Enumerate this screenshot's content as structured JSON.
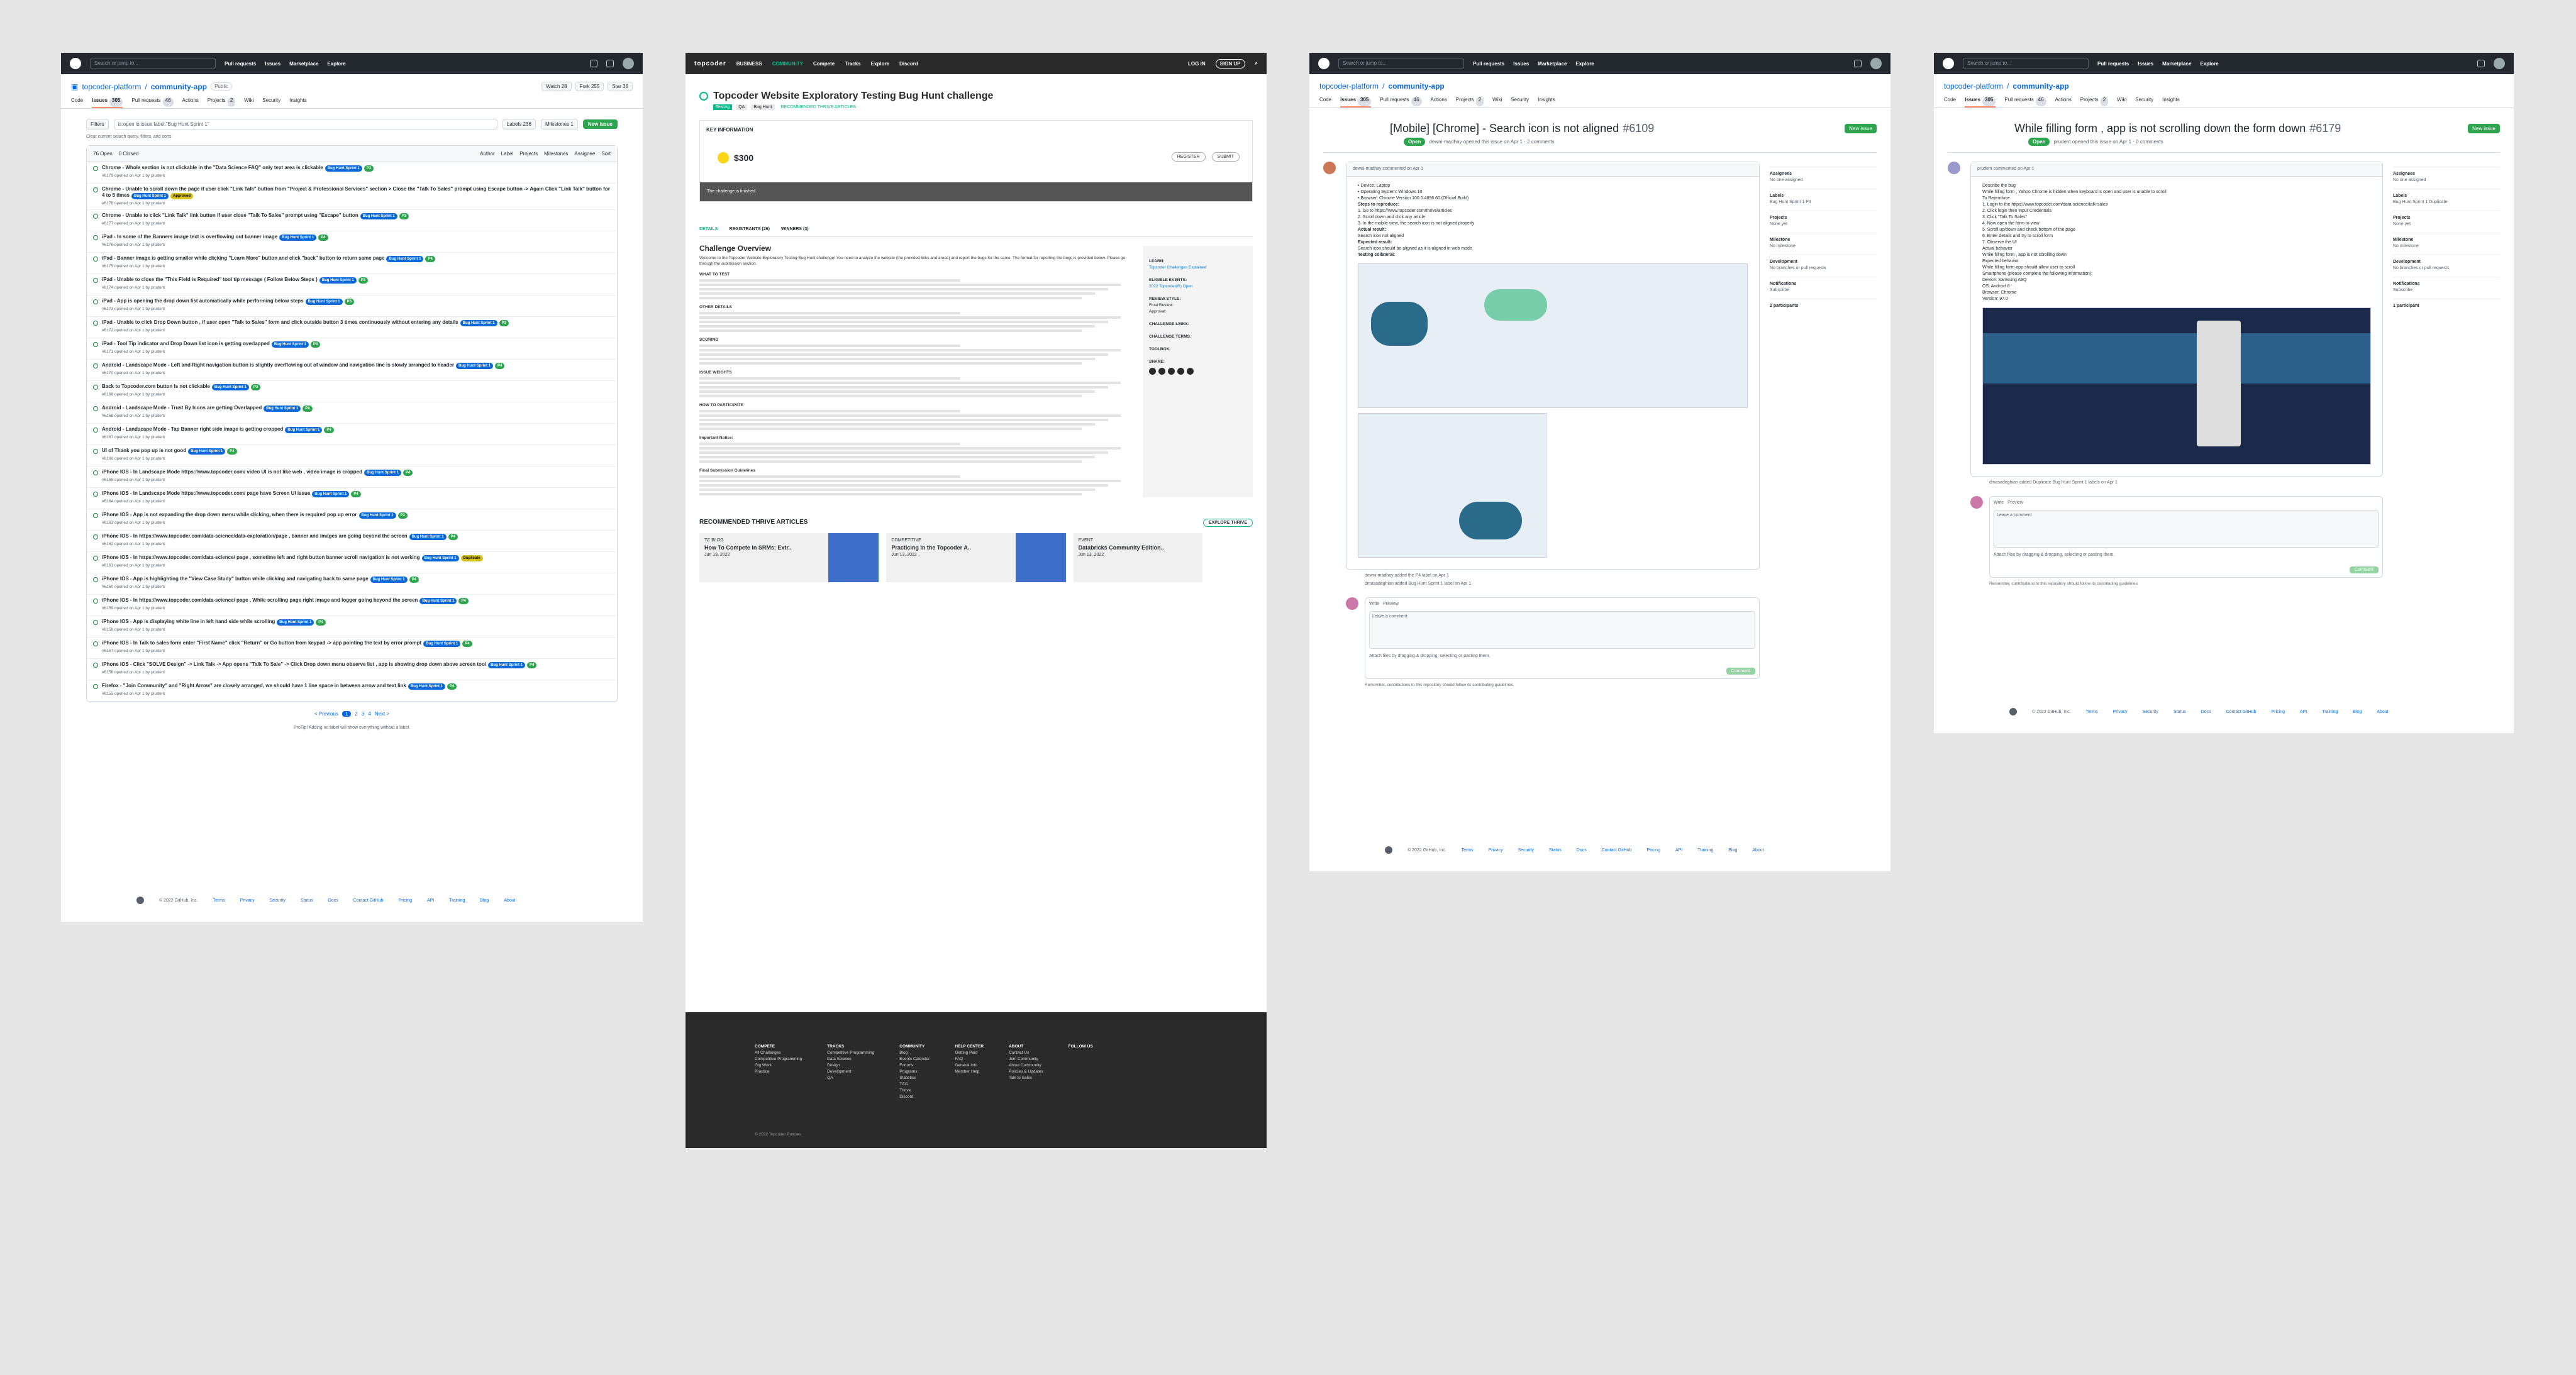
{
  "panel1": {
    "search_placeholder": "Search or jump to...",
    "nav": [
      "Pull requests",
      "Issues",
      "Marketplace",
      "Explore"
    ],
    "repo": {
      "owner": "topcoder-platform",
      "name": "community-app",
      "visibility": "Public"
    },
    "repo_buttons": [
      "Watch 28",
      "Fork 255",
      "Star 36"
    ],
    "tabs": [
      {
        "label": "Code",
        "count": ""
      },
      {
        "label": "Issues",
        "count": "305"
      },
      {
        "label": "Pull requests",
        "count": "46"
      },
      {
        "label": "Actions",
        "count": ""
      },
      {
        "label": "Projects",
        "count": "2"
      },
      {
        "label": "Wiki",
        "count": ""
      },
      {
        "label": "Security",
        "count": ""
      },
      {
        "label": "Insights",
        "count": ""
      }
    ],
    "filters_label": "Filters",
    "filter_query": "is:open is:issue label:\"Bug Hunt Sprint 1\"",
    "labels_btn": "Labels 236",
    "milestones_btn": "Milestones 1",
    "new_issue": "New issue",
    "clear_filter": "Clear current search query, filters, and sorts",
    "list_header": {
      "open": "76 Open",
      "closed": "0 Closed",
      "filters": [
        "Author",
        "Label",
        "Projects",
        "Milestones",
        "Assignee",
        "Sort"
      ]
    },
    "issues": [
      {
        "title": "Chrome - Whole section is not clickable in the \"Data Science FAQ\" only text area is clickable",
        "labels": [
          "Bug Hunt Sprint 1",
          "P3"
        ],
        "meta": "#6179 opened on Apr 1 by prudent"
      },
      {
        "title": "Chrome - Unable to scroll down the page if user click \"Link Talk\" button from \"Project & Professional Services\" section > Close the \"Talk To Sales\" prompt using Escape button -> Again Click \"Link Talk\" button for 4 to 5 times",
        "labels": [
          "Bug Hunt Sprint 1",
          "Approved"
        ],
        "meta": "#6178 opened on Apr 1 by prudent"
      },
      {
        "title": "Chrome - Unable to click \"Link Talk\" link button if user close \"Talk To Sales\" prompt using \"Escape\" button",
        "labels": [
          "Bug Hunt Sprint 1",
          "P3"
        ],
        "meta": "#6177 opened on Apr 1 by prudent"
      },
      {
        "title": "iPad - In some of the Banners image text is overflowing out banner image",
        "labels": [
          "Bug Hunt Sprint 1",
          "P4"
        ],
        "meta": "#6176 opened on Apr 1 by prudent"
      },
      {
        "title": "iPad - Banner image is getting smaller while clicking \"Learn More\" button and click \"back\" button to return same page",
        "labels": [
          "Bug Hunt Sprint 1",
          "P4"
        ],
        "meta": "#6175 opened on Apr 1 by prudent"
      },
      {
        "title": "iPad - Unable to close the \"This Field is Required\" tool tip message ( Follow Below Steps )",
        "labels": [
          "Bug Hunt Sprint 1",
          "P3"
        ],
        "meta": "#6174 opened on Apr 1 by prudent"
      },
      {
        "title": "iPad - App is opening the drop down list automatically while performing below steps",
        "labels": [
          "Bug Hunt Sprint 1",
          "P3"
        ],
        "meta": "#6173 opened on Apr 1 by prudent"
      },
      {
        "title": "iPad - Unable to click Drop Down button , if user open \"Talk to Sales\" form and click outside button 3 times continuously without entering any details",
        "labels": [
          "Bug Hunt Sprint 1",
          "P3"
        ],
        "meta": "#6172 opened on Apr 1 by prudent"
      },
      {
        "title": "iPad - Tool Tip indicator and Drop Down list icon is getting overlapped",
        "labels": [
          "Bug Hunt Sprint 1",
          "P4"
        ],
        "meta": "#6171 opened on Apr 1 by prudent"
      },
      {
        "title": "Android - Landscape Mode - Left and Right navigation button is slightly overflowing out of window and navigation line is slowly arranged to header",
        "labels": [
          "Bug Hunt Sprint 1",
          "P4"
        ],
        "meta": "#6170 opened on Apr 1 by prudent"
      },
      {
        "title": "Back to Topcoder.com button is not clickable",
        "labels": [
          "Bug Hunt Sprint 1",
          "P3"
        ],
        "meta": "#6169 opened on Apr 1 by prudent"
      },
      {
        "title": "Android - Landscape Mode - Trust By Icons are getting Overlapped",
        "labels": [
          "Bug Hunt Sprint 1",
          "P4"
        ],
        "meta": "#6168 opened on Apr 1 by prudent"
      },
      {
        "title": "Android - Landscape Mode - Tap Banner right side image is getting cropped",
        "labels": [
          "Bug Hunt Sprint 1",
          "P4"
        ],
        "meta": "#6167 opened on Apr 1 by prudent"
      },
      {
        "title": "UI of Thank you pop up is not good",
        "labels": [
          "Bug Hunt Sprint 1",
          "P4"
        ],
        "meta": "#6166 opened on Apr 1 by prudent"
      },
      {
        "title": "iPhone IOS - In Landscape Mode https://www.topcoder.com/ video UI is not like web , video image is cropped",
        "labels": [
          "Bug Hunt Sprint 1",
          "P4"
        ],
        "meta": "#6165 opened on Apr 1 by prudent"
      },
      {
        "title": "iPhone IOS - In Landscape Mode https://www.topcoder.com/ page have Screen UI issue",
        "labels": [
          "Bug Hunt Sprint 1",
          "P4"
        ],
        "meta": "#6164 opened on Apr 1 by prudent"
      },
      {
        "title": "iPhone IOS - App is not expanding the drop down menu while clicking, when there is required pop up error",
        "labels": [
          "Bug Hunt Sprint 1",
          "P3"
        ],
        "meta": "#6163 opened on Apr 1 by prudent"
      },
      {
        "title": "iPhone IOS - In https://www.topcoder.com/data-science/data-exploration/page , banner and images are going beyond the screen",
        "labels": [
          "Bug Hunt Sprint 1",
          "P4"
        ],
        "meta": "#6162 opened on Apr 1 by prudent"
      },
      {
        "title": "iPhone IOS - In https://www.topcoder.com/data-science/ page , sometime left and right button banner scroll navigation is not working",
        "labels": [
          "Bug Hunt Sprint 1",
          "Duplicate"
        ],
        "meta": "#6161 opened on Apr 1 by prudent"
      },
      {
        "title": "iPhone IOS - App is highlighting the \"View Case Study\" button while clicking and navigating back to same page",
        "labels": [
          "Bug Hunt Sprint 1",
          "P4"
        ],
        "meta": "#6160 opened on Apr 1 by prudent"
      },
      {
        "title": "iPhone IOS - In https://www.topcoder.com/data-science/ page , While scrolling page right image and logger going beyond the screen",
        "labels": [
          "Bug Hunt Sprint 1",
          "P4"
        ],
        "meta": "#6159 opened on Apr 1 by prudent"
      },
      {
        "title": "iPhone IOS - App is displaying white line in left hand side while scrolling",
        "labels": [
          "Bug Hunt Sprint 1",
          "P4"
        ],
        "meta": "#6158 opened on Apr 1 by prudent"
      },
      {
        "title": "iPhone IOS - In Talk to sales form enter \"First Name\" click \"Return\" or Go button from keypad -> app pointing the text by error prompt",
        "labels": [
          "Bug Hunt Sprint 1",
          "P4"
        ],
        "meta": "#6157 opened on Apr 1 by prudent"
      },
      {
        "title": "iPhone IOS - Click \"SOLVE Design\" -> Link Talk -> App opens \"Talk To Sale\" -> Click Drop down menu observe list , app is showing drop down above screen tool",
        "labels": [
          "Bug Hunt Sprint 1",
          "P4"
        ],
        "meta": "#6156 opened on Apr 1 by prudent"
      },
      {
        "title": "Firefox - \"Join Community\" and \"Right Arrow\" are closely arranged, we should have 1 line space in between arrow and text link",
        "labels": [
          "Bug Hunt Sprint 1",
          "P4"
        ],
        "meta": "#6155 opened on Apr 1 by prudent"
      }
    ],
    "pager": {
      "prev": "< Previous",
      "pages": [
        "1",
        "2",
        "3",
        "4"
      ],
      "next": "Next >"
    },
    "protip": "ProTip! Adding no:label will show everything without a label.",
    "footer": [
      "© 2022 GitHub, Inc.",
      "Terms",
      "Privacy",
      "Security",
      "Status",
      "Docs",
      "Contact GitHub",
      "Pricing",
      "API",
      "Training",
      "Blog",
      "About"
    ]
  },
  "panel2": {
    "brand": "topcoder",
    "nav": [
      "BUSINESS",
      "COMMUNITY",
      "Compete",
      "Tracks",
      "Explore",
      "Discord"
    ],
    "login": "LOG IN",
    "signup": "SIGN UP",
    "title": "Topcoder Website Exploratory Testing Bug Hunt challenge",
    "tags": [
      "Testing",
      "QA",
      "Bug Hunt",
      "RECOMMENDED THRIVE ARTICLES"
    ],
    "key_info": "KEY INFORMATION",
    "prize": "$300",
    "register": "REGISTER",
    "submit": "SUBMIT",
    "status_bar": "The challenge is finished.",
    "tabs": [
      "DETAILS",
      "REGISTRANTS (26)",
      "WINNERS (3)"
    ],
    "overview_title": "Challenge Overview",
    "overview_text": "Welcome to the Topcoder Website Exploratory Testing Bug Hunt challenge! You need to analyze the website (the provided links and areas) and report the bugs for the same. The format for reporting the bugs is provided below. Please go through the submission section.",
    "sections": [
      "WHAT TO TEST",
      "OTHER DETAILS",
      "SCORING",
      "ISSUE WEIGHTS",
      "HOW TO PARTICIPATE",
      "Important Notice:",
      "Final Submission Guidelines"
    ],
    "side": {
      "learn": "LEARN:",
      "learn_link": "Topcoder Challenges Explained",
      "events": "ELIGIBLE EVENTS:",
      "events_link": "2022 Topcoder(R) Open",
      "review": "REVIEW STYLE:",
      "final_review": "Final Review:",
      "approval": "Approval:",
      "links": "CHALLENGE LINKS:",
      "terms": "CHALLENGE TERMS:",
      "toolbox": "TOOLBOX:",
      "share": "SHARE:"
    },
    "thrive_title": "RECOMMENDED THRIVE ARTICLES",
    "explore_thrive": "EXPLORE THRIVE",
    "articles": [
      {
        "cat": "TC BLOG",
        "title": "How To Compete In SRMs: Extr..",
        "date": "Jun 13, 2022"
      },
      {
        "cat": "COMPETITIVE",
        "title": "Practicing In the Topcoder A..",
        "date": "Jun 13, 2022"
      },
      {
        "cat": "EVENT",
        "title": "Databricks Community Edition..",
        "date": "Jun 13, 2022"
      }
    ],
    "footer_cols": [
      {
        "h": "COMPETE",
        "items": [
          "All Challenges",
          "Competitive Programming",
          "Gig Work",
          "Practice"
        ]
      },
      {
        "h": "TRACKS",
        "items": [
          "Competitive Programming",
          "Data Science",
          "Design",
          "Development",
          "QA"
        ]
      },
      {
        "h": "COMMUNITY",
        "items": [
          "Blog",
          "Events Calendar",
          "Forums",
          "Programs",
          "Statistics",
          "TCO",
          "Thrive",
          "Discord"
        ]
      },
      {
        "h": "HELP CENTER",
        "items": [
          "Getting Paid",
          "FAQ",
          "General Info",
          "Member Help"
        ]
      },
      {
        "h": "ABOUT",
        "items": [
          "Contact Us",
          "Join Community",
          "About Community",
          "Policies & Updates",
          "Talk to Sales"
        ]
      },
      {
        "h": "FOLLOW US",
        "items": []
      }
    ],
    "copyright": "© 2022 Topcoder    Policies"
  },
  "panel3": {
    "repo": {
      "owner": "topcoder-platform",
      "name": "community-app"
    },
    "title": "[Mobile] [Chrome] - Search icon is not aligned",
    "number": "#6109",
    "new_issue": "New issue",
    "state": "Open",
    "meta": "dewni-madhay opened this issue on Apr 1 · 2 comments",
    "author": "dewni-madhay commented on Apr 1",
    "env": [
      "Device: Laptop",
      "Operating System: Windows 10",
      "Browser: Chrome Version 100.0.4896.60 (Official Build)"
    ],
    "steps_title": "Steps to reproduce:",
    "steps": [
      "Go to https://www.topcoder.com/thrive/articles",
      "Scroll down and click any article",
      "In the mobile view, the search icon is not aligned properly"
    ],
    "actual_title": "Actual result:",
    "actual": "Search icon not aligned",
    "expected_title": "Expected result:",
    "expected": "Search icon should be aligned as it is aligned in web mode",
    "testing_title": "Testing collateral:",
    "sidebar": [
      {
        "h": "Assignees",
        "v": "No one assigned"
      },
      {
        "h": "Labels",
        "v": "Bug Hunt Sprint 1  P4"
      },
      {
        "h": "Projects",
        "v": "None yet"
      },
      {
        "h": "Milestone",
        "v": "No milestone"
      },
      {
        "h": "Development",
        "v": "No branches or pull requests"
      },
      {
        "h": "Notifications",
        "v": "Subscribe"
      },
      {
        "h": "2 participants",
        "v": ""
      }
    ],
    "events": [
      "dewni-madhay added the P4 label on Apr 1",
      "dmasadeghian added Bug Hunt Sprint 1 label on Apr 1"
    ],
    "editor": {
      "write": "Write",
      "preview": "Preview",
      "placeholder": "Leave a comment",
      "attach": "Attach files by dragging & dropping, selecting or pasting them.",
      "comment": "Comment",
      "note": "Remember, contributions to this repository should follow its contributing guidelines."
    },
    "footer": [
      "© 2022 GitHub, Inc.",
      "Terms",
      "Privacy",
      "Security",
      "Status",
      "Docs",
      "Contact GitHub",
      "Pricing",
      "API",
      "Training",
      "Blog",
      "About"
    ]
  },
  "panel4": {
    "repo": {
      "owner": "topcoder-platform",
      "name": "community-app"
    },
    "title": "While filling form , app is not scrolling down the form down",
    "number": "#6179",
    "new_issue": "New issue",
    "state": "Open",
    "meta": "prudent opened this issue on Apr 1 · 0 comments",
    "author": "prudent commented on Apr 1",
    "body": [
      "Describe the bug",
      "While filling form , Yahoo Chrome is hidden when keyboard is open and user is unable to scroll",
      "To Reproduce",
      "1. Login to the https://www.topcoder.com/data-science/talk-sales",
      "2. Click login then Input Credentials",
      "3. Click \"Talk To Sales\"",
      "4. Now open the form to view",
      "5. Scroll up/down and check bottom of the page",
      "6. Enter details and try to scroll form",
      "7. Observe the UI",
      "Actual behavior",
      "While filling form , app is not scrolling down",
      "Expected behavior",
      "While filling form app should allow user to scroll",
      "Smartphone (please complete the following information):",
      "Device: Samsung A9Q",
      "OS: Android 8",
      "Browser: Chrome",
      "Version: 97.0"
    ],
    "sidebar": [
      {
        "h": "Assignees",
        "v": "No one assigned"
      },
      {
        "h": "Labels",
        "v": "Bug Hunt Sprint 1  Duplicate"
      },
      {
        "h": "Projects",
        "v": "None yet"
      },
      {
        "h": "Milestone",
        "v": "No milestone"
      },
      {
        "h": "Development",
        "v": "No branches or pull requests"
      },
      {
        "h": "Notifications",
        "v": "Subscribe"
      },
      {
        "h": "1 participant",
        "v": ""
      }
    ],
    "events": [
      "dmasadeghian added Duplicate Bug Hunt Sprint 1 labels on Apr 1"
    ],
    "editor": {
      "write": "Write",
      "preview": "Preview",
      "placeholder": "Leave a comment",
      "attach": "Attach files by dragging & dropping, selecting or pasting them.",
      "comment": "Comment",
      "note": "Remember, contributions to this repository should follow its contributing guidelines."
    },
    "footer": [
      "© 2022 GitHub, Inc.",
      "Terms",
      "Privacy",
      "Security",
      "Status",
      "Docs",
      "Contact GitHub",
      "Pricing",
      "API",
      "Training",
      "Blog",
      "About"
    ]
  }
}
